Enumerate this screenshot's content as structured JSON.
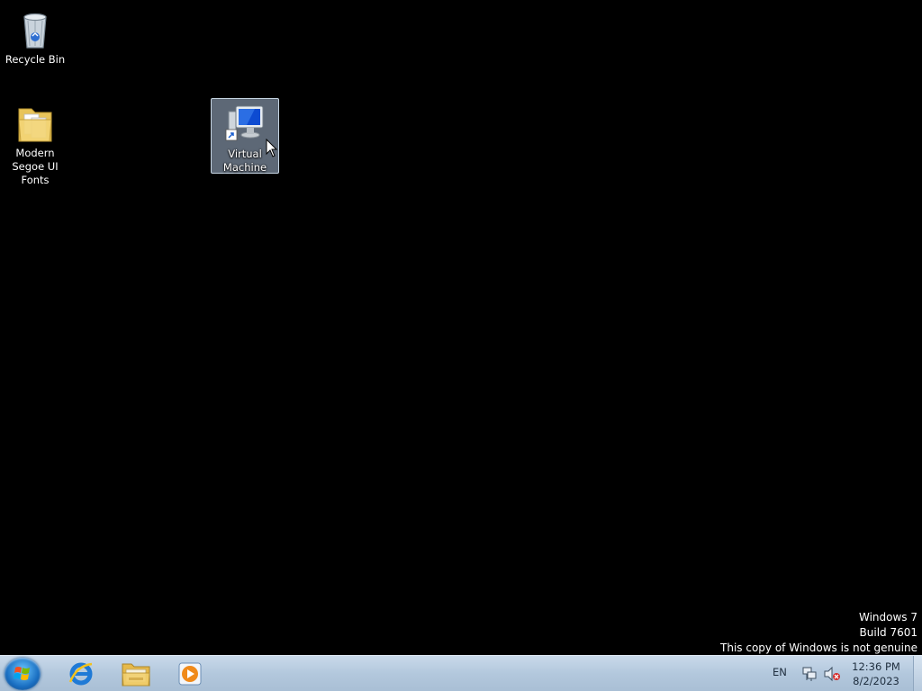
{
  "desktop": {
    "icons": [
      {
        "label": "Recycle Bin",
        "icon": "recycle-bin-icon"
      },
      {
        "label": "Modern Segoe UI Fonts",
        "icon": "folder-icon"
      },
      {
        "label": "Virtual Machine",
        "icon": "virtual-machine-shortcut-icon"
      }
    ],
    "selected_icon": "Virtual Machine"
  },
  "watermark": {
    "line1": "Windows 7",
    "line2": "Build 7601",
    "line3": "This copy of Windows is not genuine"
  },
  "taskbar": {
    "start_icon": "windows-start-orb-icon",
    "pinned": [
      {
        "name": "Internet Explorer",
        "icon": "internet-explorer-icon"
      },
      {
        "name": "Windows Explorer",
        "icon": "file-explorer-icon"
      },
      {
        "name": "Windows Media Player",
        "icon": "media-player-icon"
      }
    ],
    "tray": {
      "language": "EN",
      "time": "12:36 PM",
      "date": "8/2/2023"
    }
  },
  "colors": {
    "desktop_background": "#000000",
    "taskbar": "#b3c8dd",
    "selection": "#aabed7"
  }
}
